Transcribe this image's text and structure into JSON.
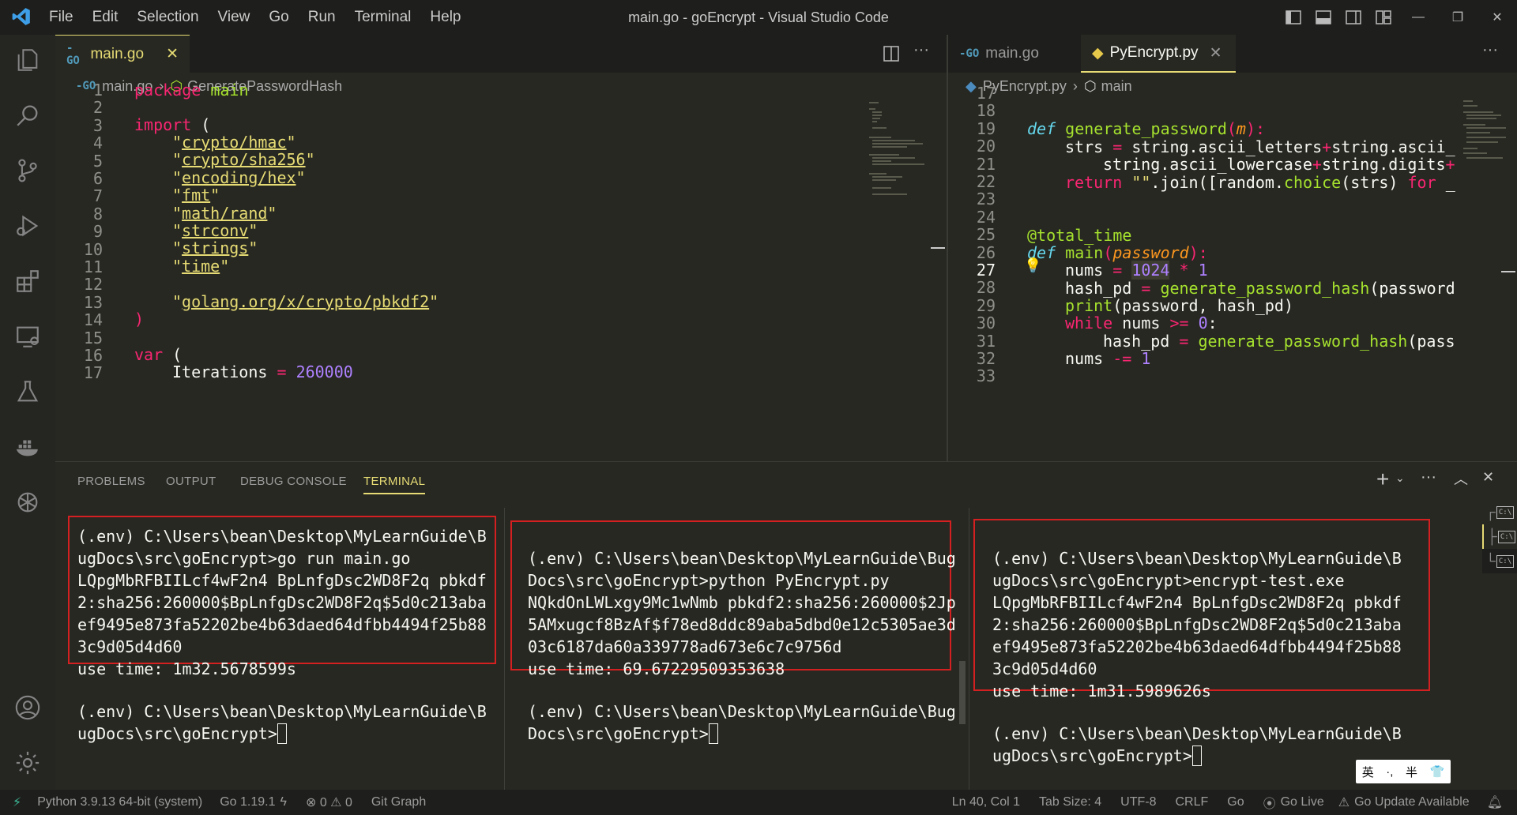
{
  "window": {
    "title": "main.go - goEncrypt - Visual Studio Code",
    "menu": [
      "File",
      "Edit",
      "Selection",
      "View",
      "Go",
      "Run",
      "Terminal",
      "Help"
    ]
  },
  "left_editor": {
    "tab": {
      "label": "main.go",
      "close": "✕"
    },
    "breadcrumb": {
      "file": "main.go",
      "symbol": "GeneratePasswordHash"
    },
    "line_numbers": [
      "1",
      "2",
      "3",
      "4",
      "5",
      "6",
      "7",
      "8",
      "9",
      "10",
      "11",
      "12",
      "13",
      "14",
      "15",
      "16",
      "17"
    ],
    "code": {
      "l1a": "package",
      "l1b": "main",
      "l3a": "import",
      "l3b": "(",
      "imports": [
        "crypto/hmac",
        "crypto/sha256",
        "encoding/hex",
        "fmt",
        "math/rand",
        "strconv",
        "strings",
        "time"
      ],
      "l13": "golang.org/x/crypto/pbkdf2",
      "l14": ")",
      "l16a": "var",
      "l16b": "(",
      "l17a": "Iterations",
      "l17b": "=",
      "l17c": "260000"
    }
  },
  "right_editor": {
    "tabs": [
      {
        "label": "main.go"
      },
      {
        "label": "PyEncrypt.py",
        "close": "✕"
      }
    ],
    "breadcrumb": {
      "file": "PyEncrypt.py",
      "symbol": "main"
    },
    "line_numbers": [
      "17",
      "18",
      "19",
      "20",
      "21",
      "22",
      "23",
      "24",
      "25",
      "26",
      "27",
      "28",
      "29",
      "30",
      "31",
      "32",
      "33"
    ],
    "code": {
      "l19a": "def",
      "l19b": "generate_password",
      "l19c": "(",
      "l19d": "m",
      "l19e": "):",
      "l20a": "strs",
      "l20b": "=",
      "l20c": "string.ascii_letters",
      "l20d": "+",
      "l20e": "string.ascii_",
      "l21a": "string.ascii_lowercase",
      "l21b": "+",
      "l21c": "string.digits",
      "l21d": "+",
      "l22a": "return",
      "l22b": "\"\"",
      "l22c": ".join([random.",
      "l22d": "choice",
      "l22e": "(strs)",
      "l22f": "for",
      "l22g": "_",
      "l25": "@total_time",
      "l26a": "def",
      "l26b": "main",
      "l26c": "(",
      "l26d": "password",
      "l26e": "):",
      "l27a": "nums",
      "l27b": "=",
      "l27c": "1024",
      "l27d": "*",
      "l27e": "1",
      "l28a": "hash_pd",
      "l28b": "=",
      "l28c": "generate_password_hash",
      "l28d": "(password",
      "l29a": "print",
      "l29b": "(password, hash_pd)",
      "l30a": "while",
      "l30b": "nums",
      "l30c": ">=",
      "l30d": "0",
      ":": ":",
      "l31a": "hash_pd",
      "l31b": "=",
      "l31c": "generate_password_hash",
      "l31d": "(pass",
      "l32a": "nums",
      "l32b": "-=",
      "l32c": "1"
    }
  },
  "panel": {
    "tabs": [
      "PROBLEMS",
      "OUTPUT",
      "DEBUG CONSOLE",
      "TERMINAL"
    ],
    "active": "TERMINAL",
    "plus": "+",
    "more": "···"
  },
  "terminals": [
    {
      "output": "(.env) C:\\Users\\bean\\Desktop\\MyLearnGuide\\B\nugDocs\\src\\goEncrypt>go run main.go\nLQpgMbRFBIILcf4wF2n4 BpLnfgDsc2WD8F2q pbkdf\n2:sha256:260000$BpLnfgDsc2WD8F2q$5d0c213aba\nef9495e873fa52202be4b63daed64dfbb4494f25b88\n3c9d05d4d60\nuse time: 1m32.5678599s",
      "prompt": "(.env) C:\\Users\\bean\\Desktop\\MyLearnGuide\\B\nugDocs\\src\\goEncrypt>"
    },
    {
      "output": "\n(.env) C:\\Users\\bean\\Desktop\\MyLearnGuide\\Bug\nDocs\\src\\goEncrypt>python PyEncrypt.py\nNQkdOnLWLxgy9Mc1wNmb pbkdf2:sha256:260000$2Jp\n5AMxugcf8BzAf$f78ed8ddc89aba5dbd0e12c5305ae3d\n03c6187da60a339778ad673e6c7c9756d\nuse time: 69.67229509353638",
      "prompt": "(.env) C:\\Users\\bean\\Desktop\\MyLearnGuide\\Bug\nDocs\\src\\goEncrypt>"
    },
    {
      "output": "\n(.env) C:\\Users\\bean\\Desktop\\MyLearnGuide\\B\nugDocs\\src\\goEncrypt>encrypt-test.exe\nLQpgMbRFBIILcf4wF2n4 BpLnfgDsc2WD8F2q pbkdf\n2:sha256:260000$BpLnfgDsc2WD8F2q$5d0c213aba\nef9495e873fa52202be4b63daed64dfbb4494f25b88\n3c9d05d4d60\nuse time: 1m31.5989626s",
      "prompt": "(.env) C:\\Users\\bean\\Desktop\\MyLearnGuide\\B\nugDocs\\src\\goEncrypt>"
    }
  ],
  "terminal_list": [
    "cmd",
    "cmd",
    "cmd"
  ],
  "ime": {
    "a": "英",
    "b": "·,",
    "c": "半",
    "d": "👕"
  },
  "status": {
    "python": "Python 3.9.13 64-bit (system)",
    "go": "Go 1.19.1",
    "problems": "⊗ 0 ⚠ 0",
    "gitgraph": "Git Graph",
    "position": "Ln 40, Col 1",
    "tabsize": "Tab Size: 4",
    "encoding": "UTF-8",
    "eol": "CRLF",
    "lang": "Go",
    "golive": "Go Live",
    "goupdate": "Go Update Available"
  },
  "colors": {
    "accent": "#e6db74",
    "keyword": "#f92672",
    "function": "#a6e22e",
    "string": "#e6db74",
    "number": "#ae81ff",
    "highlight_box": "#d42020"
  }
}
